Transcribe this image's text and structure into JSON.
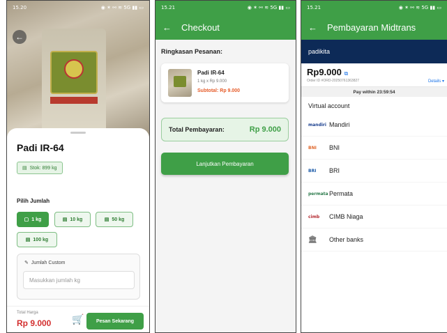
{
  "screen1": {
    "status_time": "15.20",
    "status_icons": "◉ ✶ ⚯ ≋ 5G ▮▮ ▭",
    "product_title": "Padi IR-64",
    "stock_label": "Stok: 899 kg",
    "qty_label": "Pilih Jumlah",
    "chips": [
      "1 kg",
      "10 kg",
      "50 kg",
      "100 kg"
    ],
    "custom_label": "Jumlah Custom",
    "custom_placeholder": "Masukkan jumlah kg",
    "total_label": "Total Harga",
    "total_value": "Rp 9.000",
    "buy_button": "Pesan Sekarang"
  },
  "screen2": {
    "status_time": "15.21",
    "title": "Checkout",
    "summary_title": "Ringkasan Pesanan:",
    "item_name": "Padi IR-64",
    "item_qty": "1 kg x Rp 9.000",
    "item_subtotal": "Subtotal: Rp 9.000",
    "total_label": "Total Pembayaran:",
    "total_value": "Rp 9.000",
    "continue_button": "Lanjutkan Pembayaran"
  },
  "screen3": {
    "status_time": "15.21",
    "title": "Pembayaran Midtrans",
    "merchant": "padikita",
    "amount": "Rp9.000",
    "order_id": "Order ID #ORD-20250761363827",
    "details": "Details ▾",
    "pay_within": "Pay within 23:59:54",
    "section_title": "Virtual account",
    "banks": [
      {
        "logo": "mandiri",
        "name": "Mandiri",
        "color": "#1a3f8f"
      },
      {
        "logo": "BNI",
        "name": "BNI",
        "color": "#e0662a"
      },
      {
        "logo": "BRI",
        "name": "BRI",
        "color": "#1a5aa8"
      },
      {
        "logo": "permata",
        "name": "Permata",
        "color": "#2b7a4b"
      },
      {
        "logo": "cimb",
        "name": "CIMB Niaga",
        "color": "#b3262d"
      },
      {
        "logo": "🏛",
        "name": "Other banks",
        "color": "#777777"
      }
    ]
  },
  "colors": {
    "primary_green": "#3f9f47",
    "price_red": "#d32f2f",
    "midtrans_navy": "#0d2a57"
  }
}
